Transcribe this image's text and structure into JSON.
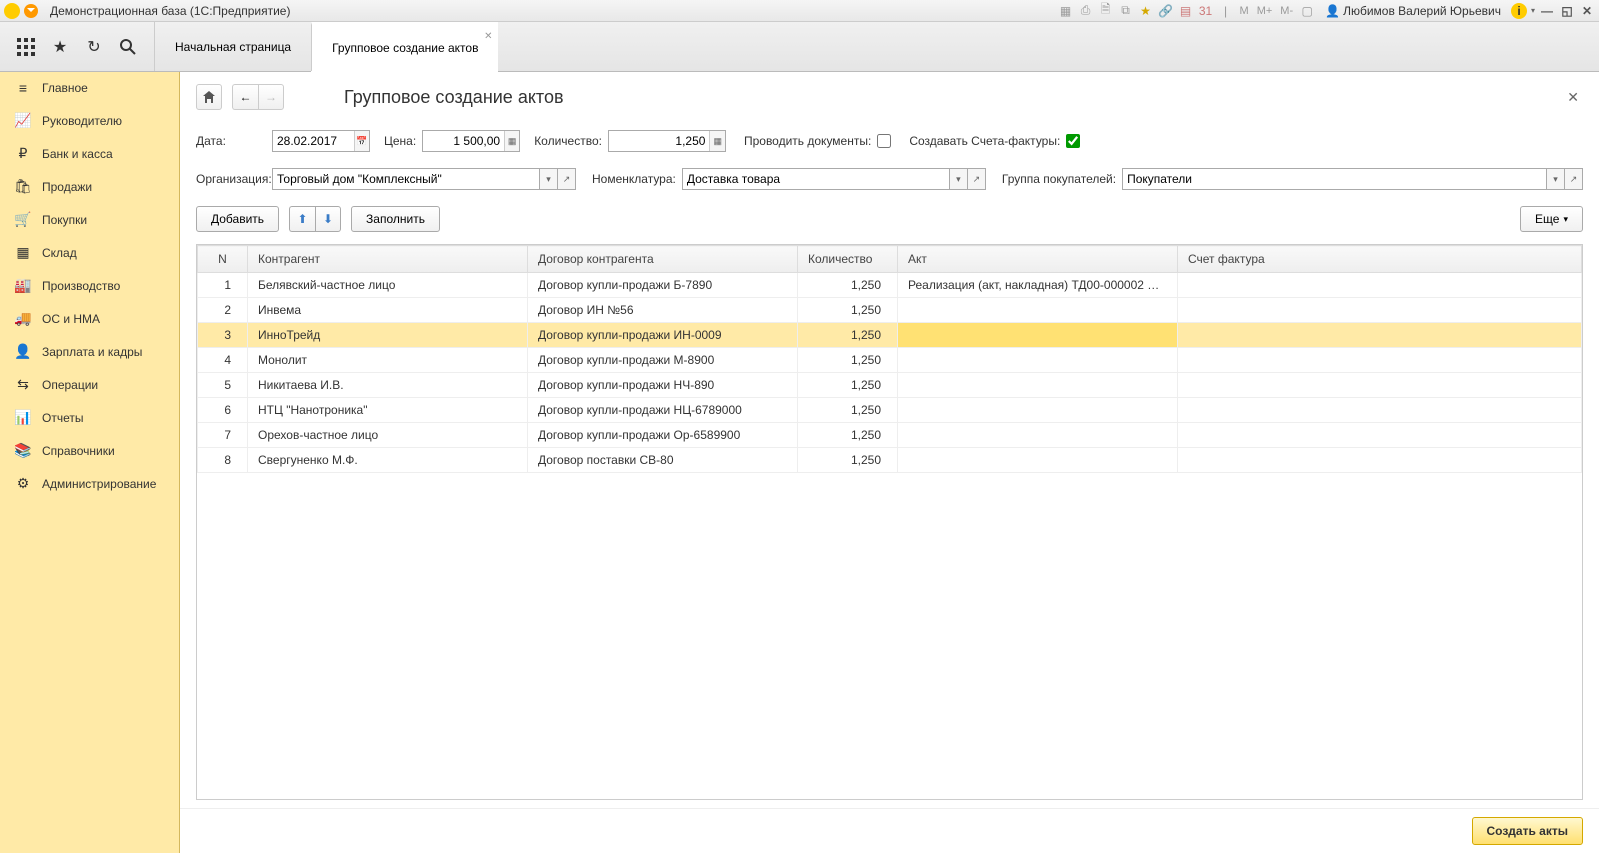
{
  "titlebar": {
    "title": "Демонстрационная база  (1С:Предприятие)",
    "user": "Любимов Валерий Юрьевич",
    "m": "М",
    "m_plus": "М+",
    "m_minus": "М-"
  },
  "tabs": [
    {
      "label": "Начальная страница"
    },
    {
      "label": "Групповое создание актов"
    }
  ],
  "sidebar": {
    "items": [
      {
        "label": "Главное"
      },
      {
        "label": "Руководителю"
      },
      {
        "label": "Банк и касса"
      },
      {
        "label": "Продажи"
      },
      {
        "label": "Покупки"
      },
      {
        "label": "Склад"
      },
      {
        "label": "Производство"
      },
      {
        "label": "ОС и НМА"
      },
      {
        "label": "Зарплата и кадры"
      },
      {
        "label": "Операции"
      },
      {
        "label": "Отчеты"
      },
      {
        "label": "Справочники"
      },
      {
        "label": "Администрирование"
      }
    ]
  },
  "page": {
    "title": "Групповое создание актов",
    "labels": {
      "date": "Дата:",
      "price": "Цена:",
      "quantity": "Количество:",
      "conduct_docs": "Проводить документы:",
      "create_invoices": "Создавать Счета-фактуры:",
      "organization": "Организация:",
      "nomenclature": "Номенклатура:",
      "buyer_group": "Группа покупателей:"
    },
    "values": {
      "date": "28.02.2017",
      "price": "1 500,00",
      "quantity": "1,250",
      "organization": "Торговый дом \"Комплексный\"",
      "nomenclature": "Доставка товара",
      "buyer_group": "Покупатели"
    },
    "toolbar": {
      "add": "Добавить",
      "fill": "Заполнить",
      "more": "Еще"
    },
    "table": {
      "headers": {
        "n": "N",
        "agent": "Контрагент",
        "contract": "Договор контрагента",
        "qty": "Количество",
        "act": "Акт",
        "invoice": "Счет фактура"
      },
      "rows": [
        {
          "n": "1",
          "agent": "Белявский-частное лицо",
          "contract": "Договор купли-продажи Б-7890",
          "qty": "1,250",
          "act": "Реализация (акт, накладная) ТД00-000002 …",
          "invoice": ""
        },
        {
          "n": "2",
          "agent": "Инвема",
          "contract": "Договор ИН №56",
          "qty": "1,250",
          "act": "",
          "invoice": ""
        },
        {
          "n": "3",
          "agent": "ИнноТрейд",
          "contract": "Договор купли-продажи ИН-0009",
          "qty": "1,250",
          "act": "",
          "invoice": ""
        },
        {
          "n": "4",
          "agent": "Монолит",
          "contract": "Договор купли-продажи М-8900",
          "qty": "1,250",
          "act": "",
          "invoice": ""
        },
        {
          "n": "5",
          "agent": "Никитаева И.В.",
          "contract": "Договор купли-продажи НЧ-890",
          "qty": "1,250",
          "act": "",
          "invoice": ""
        },
        {
          "n": "6",
          "agent": "НТЦ \"Нанотроника\"",
          "contract": "Договор купли-продажи НЦ-6789000",
          "qty": "1,250",
          "act": "",
          "invoice": ""
        },
        {
          "n": "7",
          "agent": "Орехов-частное лицо",
          "contract": "Договор купли-продажи Ор-6589900",
          "qty": "1,250",
          "act": "",
          "invoice": ""
        },
        {
          "n": "8",
          "agent": "Свергуненко М.Ф.",
          "contract": "Договор поставки СВ-80",
          "qty": "1,250",
          "act": "",
          "invoice": ""
        }
      ]
    },
    "footer": {
      "create": "Создать акты"
    }
  }
}
